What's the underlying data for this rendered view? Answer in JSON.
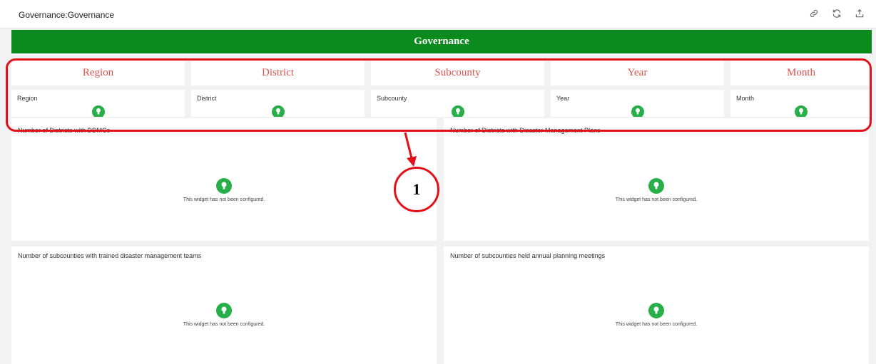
{
  "header": {
    "title": "Governance:Governance",
    "actions": [
      "link-icon",
      "refresh-icon",
      "export-icon"
    ]
  },
  "banner": {
    "title": "Governance"
  },
  "filters": [
    {
      "title": "Region",
      "label": "Region"
    },
    {
      "title": "District",
      "label": "District"
    },
    {
      "title": "Subcounty",
      "label": "Subcounty"
    },
    {
      "title": "Year",
      "label": "Year"
    },
    {
      "title": "Month",
      "label": "Month"
    }
  ],
  "annotation": {
    "number": "1"
  },
  "widgets": [
    {
      "title": "Number of Districts with DDMCs",
      "message": "This widget has not been configured."
    },
    {
      "title": "Number of Districts with Disaster Management Plans",
      "message": "This widget has not been configured."
    },
    {
      "title": "Number of subcounties with trained disaster management teams",
      "message": "This widget has not been configured."
    },
    {
      "title": "Number of subcounties held annual planning meetings",
      "message": "This widget has not been configured."
    }
  ],
  "colors": {
    "banner": "#0b8a1d",
    "filter_title": "#d9534f",
    "pin": "#27b04a",
    "highlight": "#e3101a"
  }
}
